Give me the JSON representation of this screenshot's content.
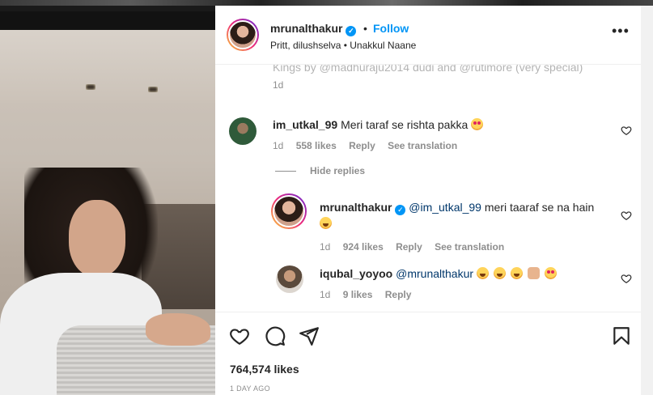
{
  "post": {
    "username": "mrunalthakur",
    "separator": "•",
    "follow_label": "Follow",
    "subtitle": "Pritt, dilushselva • Unakkul Naane",
    "more_label": "•••",
    "caption_tail": "Kings by @madhuraju2014 dudi and @rutimore (very special)",
    "caption_time": "1d"
  },
  "comments": [
    {
      "username": "im_utkal_99",
      "text": "Meri taraf se rishta pakka",
      "time": "1d",
      "likes": "558 likes",
      "reply": "Reply",
      "translation": "See translation"
    }
  ],
  "hide_replies_label": "Hide replies",
  "replies": [
    {
      "username": "mrunalthakur",
      "mention": "@im_utkal_99",
      "text": "meri taaraf se na hain",
      "time": "1d",
      "likes": "924 likes",
      "reply": "Reply",
      "translation": "See translation"
    },
    {
      "username": "iqubal_yoyoo",
      "mention": "@mrunalthakur",
      "time": "1d",
      "likes": "9 likes",
      "reply": "Reply"
    }
  ],
  "footer": {
    "likes_count": "764,574 likes",
    "time_ago": "1 DAY AGO"
  },
  "icons": {
    "verified": "verified-badge-icon",
    "like": "heart-icon",
    "comment": "comment-icon",
    "share": "share-icon",
    "save": "bookmark-icon"
  },
  "colors": {
    "accent": "#0095f6",
    "secondary_text": "#8e8e8e",
    "mention": "#00376b"
  }
}
